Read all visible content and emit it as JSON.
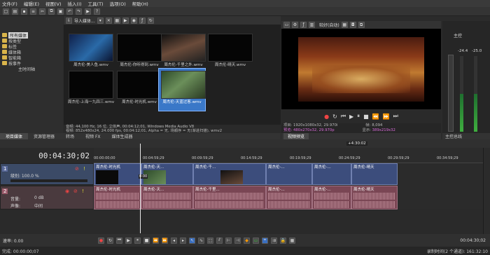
{
  "menubar": {
    "items": [
      "文件(F)",
      "编辑(E)",
      "视图(V)",
      "插入(I)",
      "工具(T)",
      "选项(O)",
      "帮助(H)"
    ]
  },
  "tree": {
    "items": [
      "所有媒体",
      "按类型",
      "标签",
      "媒体箱",
      "智能箱",
      "按事件",
      "主时间轴"
    ]
  },
  "media": {
    "header_label": "导入媒体...",
    "items": [
      {
        "label": "周杰伦-美人鱼.wmv"
      },
      {
        "label": "周杰伦-你听得到.wmv"
      },
      {
        "label": "周杰伦-千里之外.wmv"
      },
      {
        "label": "周杰伦-晴天.wmv"
      },
      {
        "label": "周杰伦-上海一九四三.wmv"
      },
      {
        "label": "周杰伦-时光机.wmv"
      },
      {
        "label": "周杰伦-天蓝过客.wmv"
      }
    ],
    "info_line1": "音频: 44,100 Hz, 16 位, 立体声, 00:04:12;01, Windows Media Audio V8",
    "info_line2": "视频: 852x480x24, 24.000 fps, 00:04:12;01, Alpha = 无, 场顺序 = 无(渐进扫描), wmv2"
  },
  "tabs": [
    "项目媒体",
    "资源管理器",
    "转场",
    "视频 FX",
    "媒体生成器"
  ],
  "preview": {
    "quality": "较好(自动)",
    "project": "项目: 1920x1080x32, 29.970i",
    "preview_res": "预览: 480x270x32, 29.970p",
    "frame_label": "帧:",
    "frame_value": "8,094",
    "display_label": "显示:",
    "display_value": "389x219x32",
    "tab_label": "视频预览"
  },
  "mixer": {
    "title": "主控",
    "left_db": "-24.4",
    "right_db": "-25.0",
    "tab_label": "主控总线"
  },
  "timeline": {
    "timecode": "00:04:30;02",
    "loop_label": "+4:30:02",
    "ruler": [
      "00:00:00;00",
      "00:04:59;29",
      "00:09:59;29",
      "00:14:59;29",
      "00:19:59;29",
      "00:24:59;29",
      "00:29:59;29",
      "00:34:59;29"
    ],
    "video_track": {
      "label": "级别: 100.0 %"
    },
    "audio_track": {
      "vol_label": "音量:",
      "vol_value": "0 dB",
      "pan_label": "声像:",
      "pan_value": "中间"
    },
    "video_clips": [
      "周杰伦-时光机",
      "周杰伦-天...",
      "周杰伦-千...",
      "周杰伦-...",
      "周杰伦-...",
      "周杰伦-晴天"
    ],
    "audio_clips": [
      "周杰伦-时光机",
      "周杰伦-天...",
      "周杰伦-千里...",
      "周杰伦-...",
      "周杰伦-...",
      "周杰伦-晴天"
    ],
    "fade_label": "0:00"
  },
  "bottom": {
    "rate_label": "速率: 0.00",
    "end_timecode": "00:04:30;02"
  },
  "status": {
    "left": "完成: 00:00:00;07",
    "right": "录制时间(2 个通道): 161:32:10"
  }
}
